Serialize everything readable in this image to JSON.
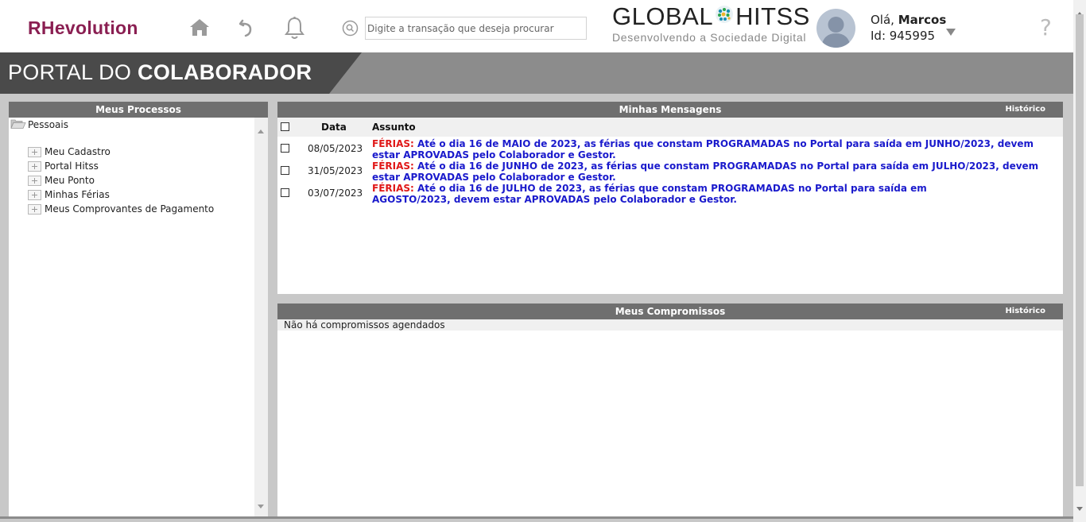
{
  "header": {
    "logo": "RHevolution",
    "search_placeholder": "Digite a transação que deseja procurar",
    "brand_left": "GLOBAL",
    "brand_right": "HITSS",
    "brand_tagline": "Desenvolvendo a Sociedade Digital",
    "greeting": "Olá",
    "user_name": "Marcos",
    "user_id": "Id: 945995",
    "help": "?"
  },
  "banner": {
    "prefix": "PORTAL DO ",
    "bold": "COLABORADOR"
  },
  "processes": {
    "title": "Meus Processos",
    "root": "Pessoais",
    "items": [
      {
        "label": "Meu Cadastro"
      },
      {
        "label": "Portal Hitss"
      },
      {
        "label": "Meu Ponto"
      },
      {
        "label": "Minhas Férias"
      },
      {
        "label": "Meus Comprovantes de Pagamento"
      }
    ]
  },
  "messages": {
    "title": "Minhas Mensagens",
    "history": "Histórico",
    "col_date": "Data",
    "col_subject": "Assunto",
    "rows": [
      {
        "date": "08/05/2023",
        "tag": "FÉRIAS:",
        "text": " Até o dia 16 de MAIO de 2023, as férias que constam PROGRAMADAS no Portal para saída em JUNHO/2023, devem estar APROVADAS pelo Colaborador e Gestor."
      },
      {
        "date": "31/05/2023",
        "tag": "FÉRIAS:",
        "text": " Até o dia 16 de JUNHO de 2023, as férias que constam PROGRAMADAS no Portal para saída em JULHO/2023, devem estar APROVADAS pelo Colaborador e Gestor."
      },
      {
        "date": "03/07/2023",
        "tag": "FÉRIAS:",
        "text": " Até o dia 16 de JULHO de 2023, as férias que constam PROGRAMADAS no Portal para saída em AGOSTO/2023, devem estar APROVADAS pelo Colaborador e Gestor."
      }
    ]
  },
  "appointments": {
    "title": "Meus Compromissos",
    "history": "Histórico",
    "empty": "Não há compromissos agendados"
  },
  "colors": {
    "logo": "#8a1f52",
    "panel_title": "#6f6f6f",
    "message_tag": "#e01818",
    "message_text": "#1a1acc"
  }
}
